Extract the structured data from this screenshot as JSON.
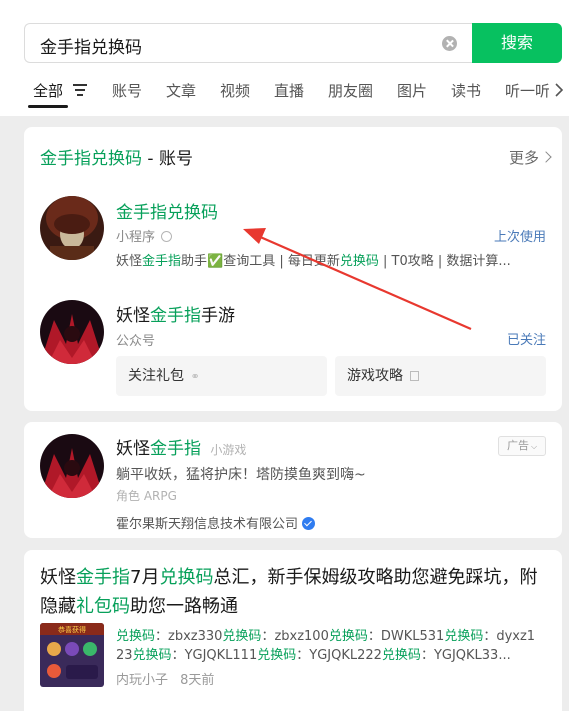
{
  "search": {
    "query": "金手指兑换码",
    "button_label": "搜索"
  },
  "tabs": [
    "全部",
    "账号",
    "文章",
    "视频",
    "直播",
    "朋友圈",
    "图片",
    "读书",
    "听一听"
  ],
  "accounts_section": {
    "title_keyword": "金手指兑换码",
    "title_suffix": " - 账号",
    "more_label": "更多",
    "mini_program": {
      "name": "金手指兑换码",
      "type": "小程序",
      "tag": "上次使用",
      "desc_parts": [
        "妖怪",
        "金手指",
        "助手✅查询工具 | 每日更新",
        "兑换码",
        " | T0攻略 | 数据计算..."
      ]
    },
    "official_account": {
      "name_parts": [
        "妖怪",
        "金手指",
        "手游"
      ],
      "type": "公众号",
      "tag": "已关注",
      "buttons": [
        "关注礼包",
        "游戏攻略"
      ]
    }
  },
  "game_card": {
    "name_parts": [
      "妖怪",
      "金手指"
    ],
    "category": "小游戏",
    "ad_label": "广告",
    "tagline": "躺平收妖，猛将护床！塔防摸鱼爽到嗨~",
    "genre": "角色 ARPG",
    "developer": "霍尔果斯天翔信息技术有限公司"
  },
  "article": {
    "title_parts": [
      "妖怪",
      "金手指",
      "7月",
      "兑换码",
      "总汇，新手保姆级攻略助您避免踩坑，附隐藏",
      "礼包码",
      "助您一路畅通"
    ],
    "snippet_line1": [
      "兑换码",
      "：zbxz330",
      "兑换码",
      "：zbxz100",
      "兑换码",
      "：DWKL531",
      "兑换码",
      "：dyxz1"
    ],
    "snippet_line2": [
      "23",
      "兑换码",
      "：YGJQKL111",
      "兑换码",
      "：YGJQKL222",
      "兑换码",
      "：YGJQKL33..."
    ],
    "thumb_caption": "恭喜获得",
    "source": "内玩小子",
    "time": "8天前"
  },
  "colors": {
    "accent_green": "#07c160",
    "keyword_green": "#07a05a",
    "annotation_arrow": "#e8382f",
    "link_blue": "#4a7ab8"
  }
}
